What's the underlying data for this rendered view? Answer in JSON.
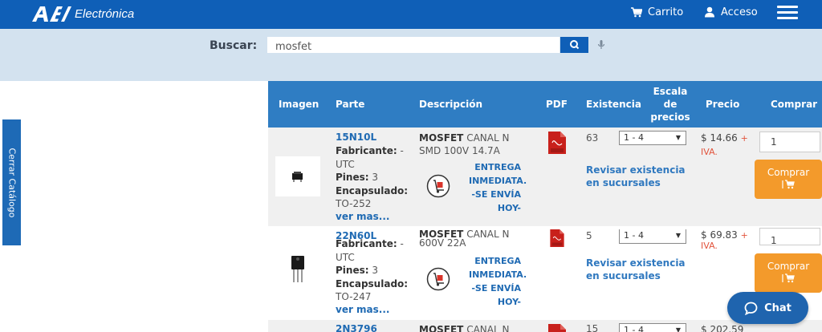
{
  "header": {
    "logo_mark": "AE",
    "logo_text": "Electrónica",
    "cart_label": "Carrito",
    "login_label": "Acceso",
    "bar_color": "#0f5fb7"
  },
  "search": {
    "label": "Buscar:",
    "value": "mosfet"
  },
  "side_tab": {
    "label": "Cerrar Catálogo"
  },
  "table": {
    "columns": {
      "image": "Imagen",
      "part": "Parte",
      "description": "Descripción",
      "pdf": "PDF",
      "stock": "Existencia",
      "scale": "Escala de precios",
      "price": "Precio",
      "buy": "Comprar"
    },
    "rows": [
      {
        "part": "15N10L",
        "fabricante_label": "Fabricante:",
        "fabricante": "- UTC",
        "pines_label": "Pines:",
        "pines": "3",
        "encapsulado_label": "Encapsulado:",
        "encapsulado": "TO-252",
        "more": "ver mas...",
        "desc_bold": "MOSFET",
        "desc_rest": "CANAL N SMD 100V 14.7A",
        "delivery": "ENTREGA INMEDIATA. -SE ENVÍA HOY-",
        "stock": "63",
        "scale": "1 - 4",
        "price": "$ 14.66",
        "iva": "+ IVA.",
        "review": "Revisar existencia en sucursales",
        "qty": "1",
        "buy": "Comprar"
      },
      {
        "part": "22N60L",
        "fabricante_label": "Fabricante:",
        "fabricante": "- UTC",
        "pines_label": "Pines:",
        "pines": "3",
        "encapsulado_label": "Encapsulado:",
        "encapsulado": "TO-247",
        "more": "ver mas...",
        "desc_bold": "MOSFET",
        "desc_rest": "CANAL N 600V 22A",
        "delivery": "ENTREGA INMEDIATA. -SE ENVÍA HOY-",
        "stock": "5",
        "scale": "1 - 4",
        "price": "$ 69.83",
        "iva": "+ IVA.",
        "review": "Revisar existencia en sucursales",
        "qty": "1",
        "buy": "Comprar"
      },
      {
        "part": "2N3796",
        "desc_bold": "MOSFET",
        "desc_rest": "CANAL N",
        "stock": "15",
        "scale": "1 - 4",
        "price": "$ 202.59"
      }
    ]
  },
  "chat": {
    "label": "Chat"
  },
  "colors": {
    "header_blue": "#0f5fb7",
    "table_header": "#2f7dc3",
    "buy_orange": "#f39a2b",
    "iva_red": "#e2543d",
    "search_band": "#d3e2ef"
  }
}
